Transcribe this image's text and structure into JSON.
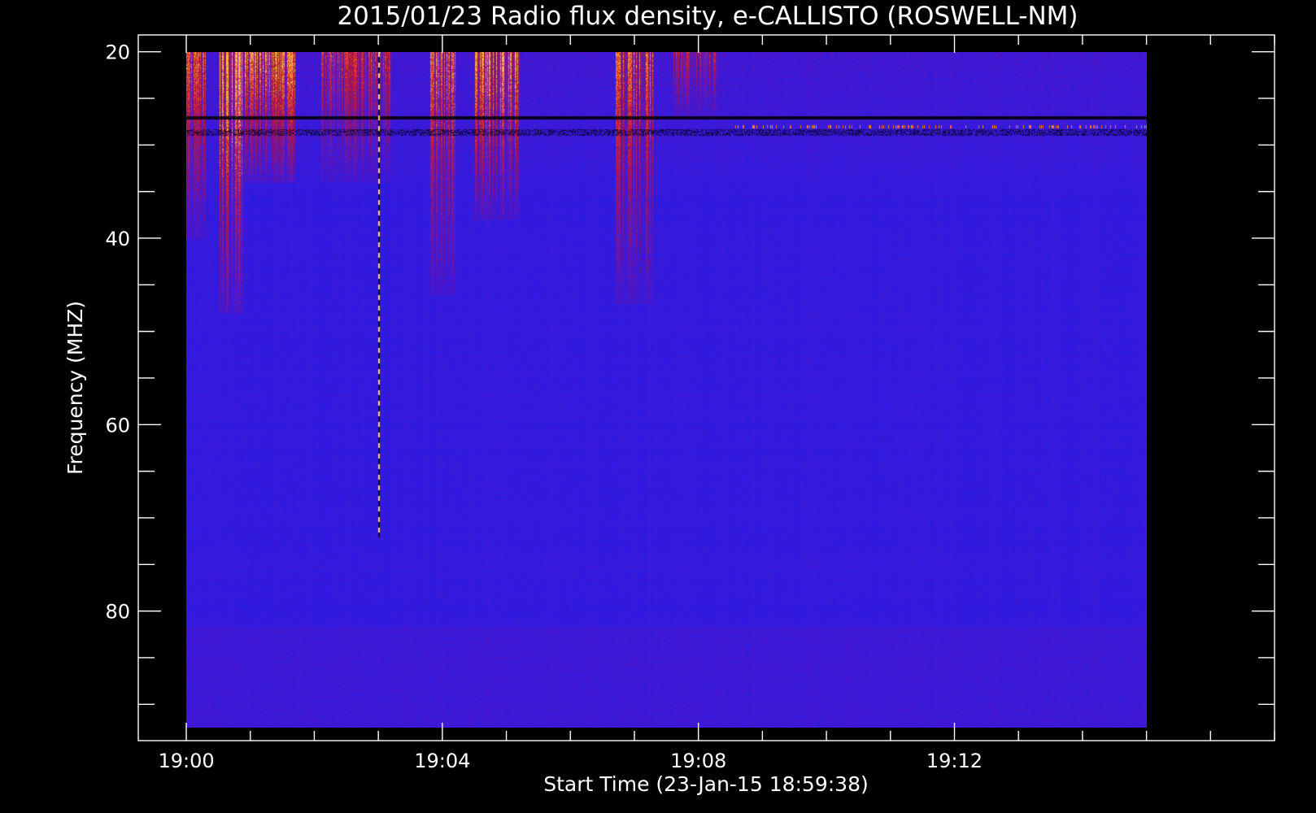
{
  "chart_data": {
    "type": "heatmap",
    "title": "2015/01/23  Radio flux density, e-CALLISTO (ROSWELL-NM)",
    "xlabel": "Start Time (23-Jan-15 18:59:38)",
    "ylabel": "Frequency (MHZ)",
    "x_unit": "minutes after 19:00 UT",
    "x_data_range": [
      0,
      15
    ],
    "xlim": [
      -0.75,
      17
    ],
    "x_ticks": [
      {
        "value": 0,
        "label": "19:00"
      },
      {
        "value": 4,
        "label": "19:04"
      },
      {
        "value": 8,
        "label": "19:08"
      },
      {
        "value": 12,
        "label": "19:12"
      }
    ],
    "x_minor_step": 1,
    "y_data_range": [
      20,
      92.5
    ],
    "ylim": [
      18.2,
      93.9
    ],
    "y_inverted": true,
    "y_ticks": [
      {
        "value": 20,
        "label": "20"
      },
      {
        "value": 40,
        "label": "40"
      },
      {
        "value": 60,
        "label": "60"
      },
      {
        "value": 80,
        "label": "80"
      }
    ],
    "y_minor_step": 5,
    "colors": {
      "background": "#000000",
      "axes": "#ffffff",
      "low_flux": "#1e1ef2",
      "mid_flux": "#8c1a7a",
      "high_flux": "#e02010",
      "peak_flux": "#ffc040",
      "gap": "#050520"
    },
    "burst_groups": [
      {
        "t_start": 0.0,
        "t_end": 0.3,
        "f_top": 20,
        "f_bottom": 40,
        "intensity": 0.7
      },
      {
        "t_start": 0.5,
        "t_end": 0.9,
        "f_top": 20,
        "f_bottom": 48,
        "intensity": 1.0
      },
      {
        "t_start": 0.9,
        "t_end": 1.7,
        "f_top": 20,
        "f_bottom": 34,
        "intensity": 0.85
      },
      {
        "t_start": 2.1,
        "t_end": 3.2,
        "f_top": 20,
        "f_bottom": 34,
        "intensity": 0.6
      },
      {
        "t_start": 3.8,
        "t_end": 4.2,
        "f_top": 20,
        "f_bottom": 46,
        "intensity": 0.75
      },
      {
        "t_start": 4.5,
        "t_end": 5.2,
        "f_top": 20,
        "f_bottom": 38,
        "intensity": 0.9
      },
      {
        "t_start": 6.7,
        "t_end": 7.3,
        "f_top": 20,
        "f_bottom": 47,
        "intensity": 0.75
      },
      {
        "t_start": 7.6,
        "t_end": 8.3,
        "f_top": 20,
        "f_bottom": 27,
        "intensity": 0.5
      }
    ],
    "narrowband_features": [
      {
        "frequency": 28,
        "t_start": 8.5,
        "t_end": 15,
        "description": "intermittent narrowband emission near 28 MHz"
      },
      {
        "frequency": 27,
        "t_start": 0,
        "t_end": 15,
        "description": "dark absorption line near 27 MHz"
      }
    ],
    "vertical_streak": {
      "t": 3.0,
      "f_top": 20,
      "f_bottom": 72
    }
  }
}
